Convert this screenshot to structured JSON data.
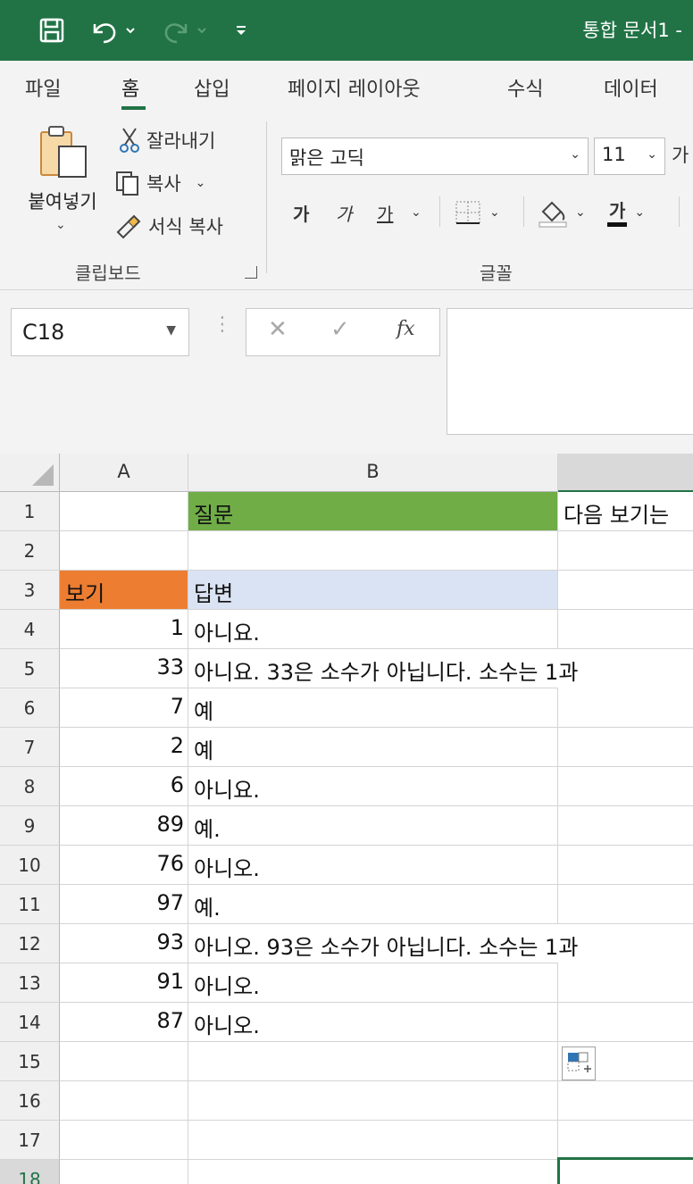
{
  "titlebar": {
    "title": "통합 문서1 -",
    "icons": [
      "save-icon",
      "undo-icon",
      "redo-icon",
      "customize-quick-access-icon"
    ],
    "accent_color": "#217346"
  },
  "ribbon": {
    "tabs": [
      "파일",
      "홈",
      "삽입",
      "페이지 레이아웃",
      "수식",
      "데이터"
    ],
    "active_tab": "홈",
    "clipboard": {
      "paste_label": "붙여넣기",
      "cut_label": "잘라내기",
      "copy_label": "복사",
      "format_painter_label": "서식 복사",
      "group_label": "클립보드"
    },
    "font": {
      "font_name": "맑은 고딕",
      "font_size": "11",
      "grow_label": "가",
      "bold_label": "가",
      "italic_label": "가",
      "underline_label": "가",
      "font_color_label": "가",
      "group_label": "글꼴"
    }
  },
  "formula_bar": {
    "name_box": "C18",
    "cancel_symbol": "✕",
    "enter_symbol": "✓",
    "fx_label": "fx",
    "formula": ""
  },
  "grid": {
    "columns": [
      "A",
      "B"
    ],
    "row_numbers": [
      "1",
      "2",
      "3",
      "4",
      "5",
      "6",
      "7",
      "8",
      "9",
      "10",
      "11",
      "12",
      "13",
      "14",
      "15",
      "16",
      "17",
      "18"
    ],
    "selected_row": "18",
    "header_row": {
      "question_label": "질문",
      "question_text": "다음 보기는",
      "view_label": "보기",
      "answer_label": "답변"
    },
    "rows": [
      {
        "value": "1",
        "answer": "아니요."
      },
      {
        "value": "33",
        "answer": "아니요. 33은 소수가 아닙니다. 소수는 1과"
      },
      {
        "value": "7",
        "answer": "예"
      },
      {
        "value": "2",
        "answer": "예"
      },
      {
        "value": "6",
        "answer": "아니요."
      },
      {
        "value": "89",
        "answer": "예."
      },
      {
        "value": "76",
        "answer": "아니오."
      },
      {
        "value": "97",
        "answer": "예."
      },
      {
        "value": "93",
        "answer": "아니오. 93은 소수가 아닙니다. 소수는 1과"
      },
      {
        "value": "91",
        "answer": "아니오."
      },
      {
        "value": "87",
        "answer": "아니오."
      }
    ],
    "colors": {
      "question_fill": "#70ad47",
      "view_fill": "#ed7d31",
      "answer_fill": "#dae3f3"
    }
  }
}
